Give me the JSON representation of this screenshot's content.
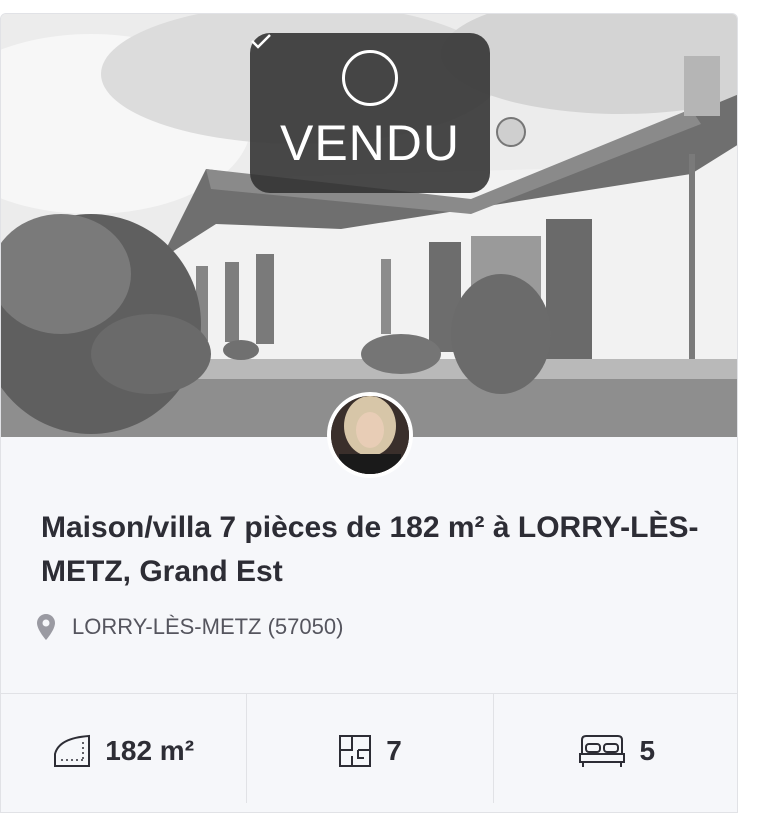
{
  "listing": {
    "status_label": "VENDU",
    "title": "Maison/villa 7 pièces de 182 m² à LORRY-LÈS-METZ, Grand Est",
    "location": "LORRY-LÈS-METZ (57050)"
  },
  "stats": {
    "surface": "182 m²",
    "rooms": "7",
    "bedrooms": "5"
  },
  "icons": {
    "status": "check-circle-icon",
    "location": "map-pin-icon",
    "surface": "surface-area-icon",
    "rooms": "floor-plan-icon",
    "bedrooms": "bed-icon"
  },
  "colors": {
    "badge_bg": "#303030",
    "card_bg": "#f6f7fa",
    "text": "#2d2d35"
  }
}
